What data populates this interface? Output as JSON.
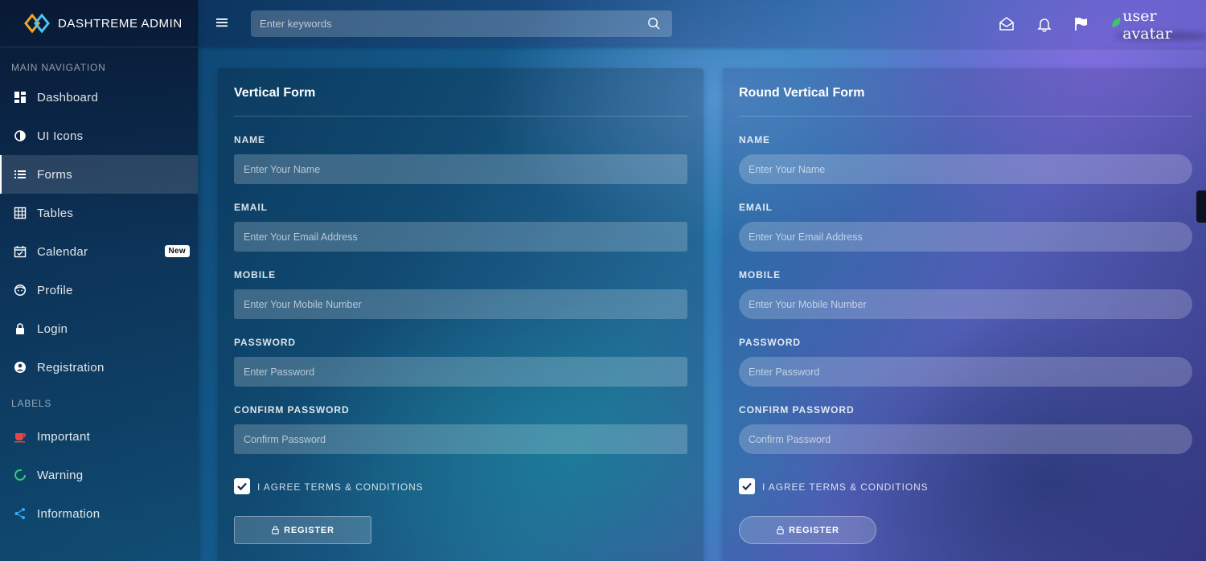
{
  "app": {
    "brand": "DASHTREME ADMIN"
  },
  "sidebar": {
    "main_header": "MAIN NAVIGATION",
    "items": [
      {
        "label": "Dashboard",
        "icon": "dashboard-icon"
      },
      {
        "label": "UI Icons",
        "icon": "contrast-icon"
      },
      {
        "label": "Forms",
        "icon": "list-icon",
        "active": true
      },
      {
        "label": "Tables",
        "icon": "grid-icon"
      },
      {
        "label": "Calendar",
        "icon": "calendar-check-icon",
        "badge": "New"
      },
      {
        "label": "Profile",
        "icon": "face-icon"
      },
      {
        "label": "Login",
        "icon": "lock-icon"
      },
      {
        "label": "Registration",
        "icon": "account-circle-icon"
      }
    ],
    "labels_header": "LABELS",
    "labels": [
      {
        "label": "Important",
        "icon": "coffee-icon",
        "color": "#e64545"
      },
      {
        "label": "Warning",
        "icon": "spinner-icon",
        "color": "#2ecc71"
      },
      {
        "label": "Information",
        "icon": "share-icon",
        "color": "#3aa8f0"
      }
    ]
  },
  "topbar": {
    "search_placeholder": "Enter keywords",
    "avatar_alt": "user avatar"
  },
  "forms": {
    "vertical": {
      "title": "Vertical Form",
      "name_label": "NAME",
      "name_placeholder": "Enter Your Name",
      "email_label": "EMAIL",
      "email_placeholder": "Enter Your Email Address",
      "mobile_label": "MOBILE",
      "mobile_placeholder": "Enter Your Mobile Number",
      "password_label": "PASSWORD",
      "password_placeholder": "Enter Password",
      "confirm_label": "CONFIRM PASSWORD",
      "confirm_placeholder": "Confirm Password",
      "agree_label": "I AGREE TERMS & CONDITIONS",
      "agree_checked": true,
      "register_label": "REGISTER"
    },
    "round": {
      "title": "Round Vertical Form",
      "name_label": "NAME",
      "name_placeholder": "Enter Your Name",
      "email_label": "EMAIL",
      "email_placeholder": "Enter Your Email Address",
      "mobile_label": "MOBILE",
      "mobile_placeholder": "Enter Your Mobile Number",
      "password_label": "PASSWORD",
      "password_placeholder": "Enter Password",
      "confirm_label": "CONFIRM PASSWORD",
      "confirm_placeholder": "Confirm Password",
      "agree_label": "I AGREE TERMS & CONDITIONS",
      "agree_checked": true,
      "register_label": "REGISTER"
    }
  }
}
